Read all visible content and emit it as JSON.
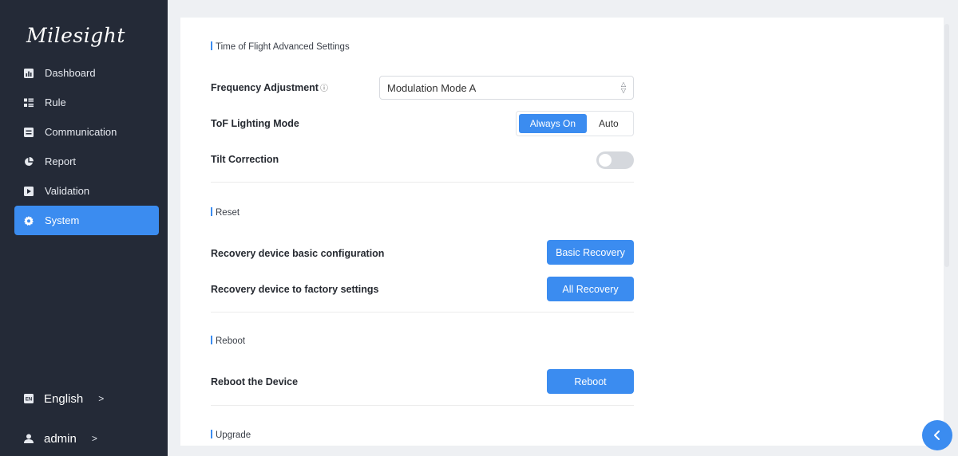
{
  "brand": {
    "name": "Milesight"
  },
  "sidebar": {
    "items": [
      {
        "label": "Dashboard",
        "icon": "dashboard-icon"
      },
      {
        "label": "Rule",
        "icon": "rule-icon"
      },
      {
        "label": "Communication",
        "icon": "communication-icon"
      },
      {
        "label": "Report",
        "icon": "report-pie-icon"
      },
      {
        "label": "Validation",
        "icon": "validation-icon"
      },
      {
        "label": "System",
        "icon": "gear-icon",
        "active": true
      }
    ],
    "language": {
      "label": "English",
      "icon": "en-badge-icon",
      "badge": "EN"
    },
    "user": {
      "label": "admin",
      "icon": "user-icon"
    }
  },
  "tof": {
    "title": "Time of Flight Advanced Settings",
    "frequency": {
      "label": "Frequency Adjustment",
      "info_glyph": "ⓘ",
      "value": "Modulation Mode A"
    },
    "lighting": {
      "label": "ToF Lighting Mode",
      "options": [
        "Always On",
        "Auto"
      ],
      "selected": "Always On"
    },
    "tilt": {
      "label": "Tilt Correction",
      "enabled": false
    }
  },
  "reset": {
    "title": "Reset",
    "basic": {
      "label": "Recovery device basic configuration",
      "button": "Basic Recovery"
    },
    "factory": {
      "label": "Recovery device to factory settings",
      "button": "All Recovery"
    }
  },
  "reboot": {
    "title": "Reboot",
    "device": {
      "label": "Reboot the Device",
      "button": "Reboot"
    }
  },
  "upgrade": {
    "title": "Upgrade"
  },
  "colors": {
    "accent": "#3b8cf0",
    "sidebar_bg": "#242a37",
    "page_bg": "#eef0f3"
  }
}
